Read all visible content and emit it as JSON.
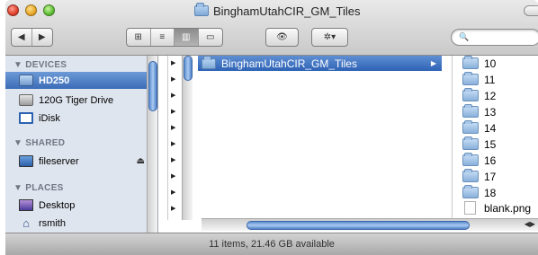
{
  "window": {
    "title": "BinghamUtahCIR_GM_Tiles"
  },
  "toolbar": {
    "back_glyph": "◀",
    "forward_glyph": "▶",
    "view_icon_glyph": "⊞",
    "view_list_glyph": "≡",
    "view_column_glyph": "▥",
    "view_coverflow_glyph": "▭",
    "quicklook_glyph": "👁",
    "action_glyph": "✲▾",
    "search_glyph": "🔍",
    "search_placeholder": ""
  },
  "sidebar": {
    "devices_header": "▼ DEVICES",
    "shared_header": "▼ SHARED",
    "places_header": "▼ PLACES",
    "devices": [
      {
        "label": "HD250",
        "icon": "drive-icon"
      },
      {
        "label": "120G Tiger Drive",
        "icon": "drive-icon"
      },
      {
        "label": "iDisk",
        "icon": "idisk-icon"
      }
    ],
    "shared": [
      {
        "label": "fileserver",
        "icon": "monitor-icon",
        "eject": "⏏"
      }
    ],
    "places": [
      {
        "label": "Desktop",
        "icon": "desktop-icon"
      },
      {
        "label": "rsmith",
        "icon": "home-icon"
      }
    ]
  },
  "columns": {
    "selected_folder": "BinghamUtahCIR_GM_Tiles",
    "files": [
      {
        "name": "10",
        "type": "folder"
      },
      {
        "name": "11",
        "type": "folder"
      },
      {
        "name": "12",
        "type": "folder"
      },
      {
        "name": "13",
        "type": "folder"
      },
      {
        "name": "14",
        "type": "folder"
      },
      {
        "name": "15",
        "type": "folder"
      },
      {
        "name": "16",
        "type": "folder"
      },
      {
        "name": "17",
        "type": "folder"
      },
      {
        "name": "18",
        "type": "folder"
      },
      {
        "name": "blank.png",
        "type": "file"
      }
    ]
  },
  "status": {
    "text": "11 items, 21.46 GB available"
  }
}
